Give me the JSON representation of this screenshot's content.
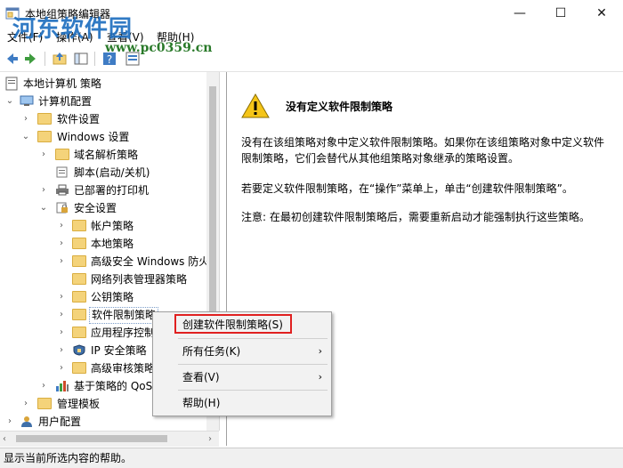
{
  "window": {
    "title": "本地组策略编辑器",
    "minimize": "—",
    "maximize": "☐",
    "close": "✕"
  },
  "watermark": {
    "text": "河东软件园",
    "url": "www.pc0359.cn"
  },
  "menu": {
    "file": "文件(F)",
    "action": "操作(A)",
    "view": "查看(V)",
    "help": "帮助(H)"
  },
  "tree": {
    "root": "本地计算机 策略",
    "computer_config": "计算机配置",
    "software_settings": "软件设置",
    "windows_settings": "Windows 设置",
    "dns_policy": "域名解析策略",
    "scripts": "脚本(启动/关机)",
    "printers": "已部署的打印机",
    "security_settings": "安全设置",
    "account_policies": "帐户策略",
    "local_policies": "本地策略",
    "firewall": "高级安全 Windows 防火",
    "network_list": "网络列表管理器策略",
    "public_key": "公钥策略",
    "srp": "软件限制策略",
    "app_control": "应用程序控制",
    "ip_security": "IP 安全策略",
    "audit": "高级审核策略",
    "qos": "基于策略的 QoS",
    "admin_templates": "管理模板",
    "user_config": "用户配置"
  },
  "pane": {
    "title": "没有定义软件限制策略",
    "para1": "没有在该组策略对象中定义软件限制策略。如果你在该组策略对象中定义软件限制策略，它们会替代从其他组策略对象继承的策略设置。",
    "para2": "若要定义软件限制策略，在“操作”菜单上，单击“创建软件限制策略”。",
    "para3": "注意: 在最初创建软件限制策略后，需要重新启动才能强制执行这些策略。"
  },
  "context_menu": {
    "create": "创建软件限制策略(S)",
    "all_tasks": "所有任务(K)",
    "view": "查看(V)",
    "help": "帮助(H)",
    "submenu_arrow": "›"
  },
  "status": {
    "text": "显示当前所选内容的帮助。"
  },
  "colors": {
    "highlight_border": "#e02020",
    "folder": "#f4d37a",
    "warning": "#f5c518"
  }
}
